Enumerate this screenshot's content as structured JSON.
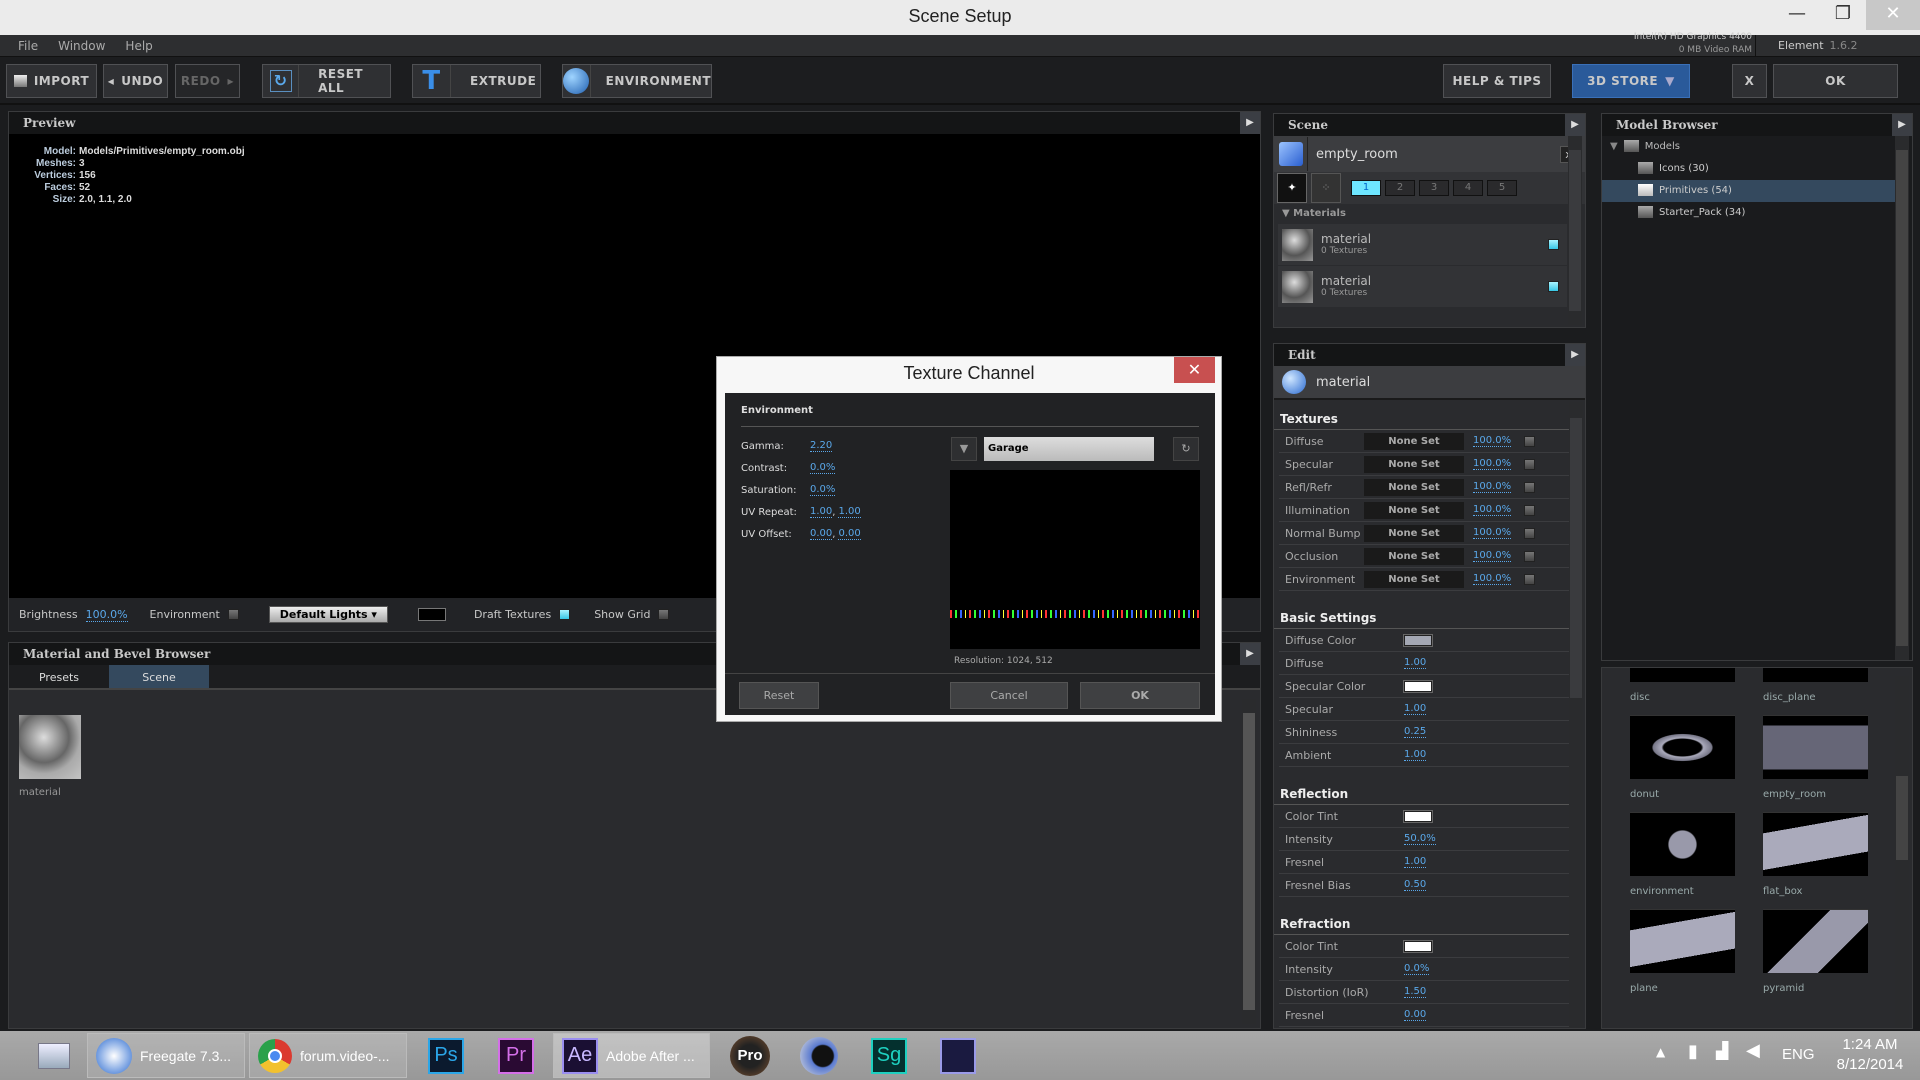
{
  "window": {
    "title": "Scene Setup",
    "min": "—",
    "max": "❐",
    "close": "✕"
  },
  "menu": [
    "File",
    "Window",
    "Help"
  ],
  "gpu": {
    "name": "Intel(R) HD Graphics 4400",
    "vram": "0 MB Video RAM"
  },
  "version": {
    "app": "Element",
    "number": "1.6.2"
  },
  "toolbar": {
    "import": "IMPORT",
    "undo": "UNDO",
    "redo": "REDO",
    "reset_all": "RESET ALL",
    "extrude": "EXTRUDE",
    "environment": "ENVIRONMENT",
    "help": "HELP & TIPS",
    "store": "3D STORE",
    "x": "X",
    "ok": "OK"
  },
  "preview": {
    "title": "Preview",
    "info": [
      [
        "Model:",
        "Models/Primitives/empty_room.obj"
      ],
      [
        "Meshes:",
        "3"
      ],
      [
        "Vertices:",
        "156"
      ],
      [
        "Faces:",
        "52"
      ],
      [
        "Size:",
        "2.0, 1.1, 2.0"
      ]
    ],
    "bottom": {
      "brightness_label": "Brightness",
      "brightness": "100.0%",
      "environment": "Environment",
      "lights": "Default Lights",
      "draft": "Draft Textures",
      "grid": "Show Grid",
      "draft_on": true
    }
  },
  "material_browser": {
    "title": "Material and Bevel Browser",
    "tabs": [
      "Presets",
      "Scene"
    ],
    "active_tab": "Scene",
    "items": [
      "material"
    ]
  },
  "scene": {
    "title": "Scene",
    "object": "empty_room",
    "close": "x",
    "groups": [
      "1",
      "2",
      "3",
      "4",
      "5"
    ],
    "materials_label": "Materials",
    "materials": [
      {
        "name": "material",
        "sub": "0 Textures"
      },
      {
        "name": "material",
        "sub": "0 Textures"
      }
    ]
  },
  "edit": {
    "title": "Edit",
    "material": "material",
    "textures_label": "Textures",
    "textures": [
      {
        "name": "Diffuse",
        "value": "None Set",
        "pct": "100.0%"
      },
      {
        "name": "Specular",
        "value": "None Set",
        "pct": "100.0%"
      },
      {
        "name": "Refl/Refr",
        "value": "None Set",
        "pct": "100.0%"
      },
      {
        "name": "Illumination",
        "value": "None Set",
        "pct": "100.0%"
      },
      {
        "name": "Normal Bump",
        "value": "None Set",
        "pct": "100.0%"
      },
      {
        "name": "Occlusion",
        "value": "None Set",
        "pct": "100.0%"
      },
      {
        "name": "Environment",
        "value": "None Set",
        "pct": "100.0%"
      }
    ],
    "sections": [
      {
        "title": "Basic Settings",
        "rows": [
          {
            "name": "Diffuse Color",
            "color": "#a4a8b4"
          },
          {
            "name": "Diffuse",
            "value": "1.00"
          },
          {
            "name": "Specular Color",
            "color": "#ffffff"
          },
          {
            "name": "Specular",
            "value": "1.00"
          },
          {
            "name": "Shininess",
            "value": "0.25"
          },
          {
            "name": "Ambient",
            "value": "1.00"
          }
        ]
      },
      {
        "title": "Reflection",
        "rows": [
          {
            "name": "Color Tint",
            "color": "#ffffff"
          },
          {
            "name": "Intensity",
            "value": "50.0%"
          },
          {
            "name": "Fresnel",
            "value": "1.00"
          },
          {
            "name": "Fresnel Bias",
            "value": "0.50"
          }
        ]
      },
      {
        "title": "Refraction",
        "rows": [
          {
            "name": "Color Tint",
            "color": "#ffffff"
          },
          {
            "name": "Intensity",
            "value": "0.0%"
          },
          {
            "name": "Distortion (IoR)",
            "value": "1.50"
          },
          {
            "name": "Fresnel",
            "value": "0.00"
          }
        ]
      }
    ]
  },
  "model_browser": {
    "title": "Model Browser",
    "root": "Models",
    "folders": [
      "Icons (30)",
      "Primitives (54)",
      "Starter_Pack (34)"
    ],
    "selected": "Primitives (54)",
    "thumbs": [
      "disc",
      "disc_plane",
      "donut",
      "empty_room",
      "environment",
      "flat_box",
      "plane",
      "pyramid"
    ]
  },
  "dialog": {
    "title": "Texture Channel",
    "section": "Environment",
    "fields": [
      {
        "label": "Gamma:",
        "values": [
          "2.20"
        ]
      },
      {
        "label": "Contrast:",
        "values": [
          "0.0%"
        ]
      },
      {
        "label": "Saturation:",
        "values": [
          "0.0%"
        ]
      },
      {
        "label": "UV Repeat:",
        "values": [
          "1.00",
          "1.00"
        ]
      },
      {
        "label": "UV Offset:",
        "values": [
          "0.00",
          "0.00"
        ]
      }
    ],
    "texture": "Garage",
    "resolution": "Resolution: 1024, 512",
    "reset": "Reset",
    "cancel": "Cancel",
    "ok": "OK"
  },
  "taskbar": {
    "apps": [
      {
        "label": "Freegate 7.3..."
      },
      {
        "label": "forum.video-..."
      },
      {
        "label": "Adobe After ..."
      }
    ],
    "icons": {
      "ps": "Ps",
      "pr": "Pr",
      "ae": "Ae",
      "pro": "Pro",
      "sg": "Sg"
    },
    "lang": "ENG",
    "time": "1:24 AM",
    "date": "8/12/2014"
  },
  "colors": {
    "accent": "#37c6e5",
    "link": "#5aa8ea",
    "selection": "#34495e",
    "store": "#2a5a9a",
    "close": "#c85050"
  }
}
